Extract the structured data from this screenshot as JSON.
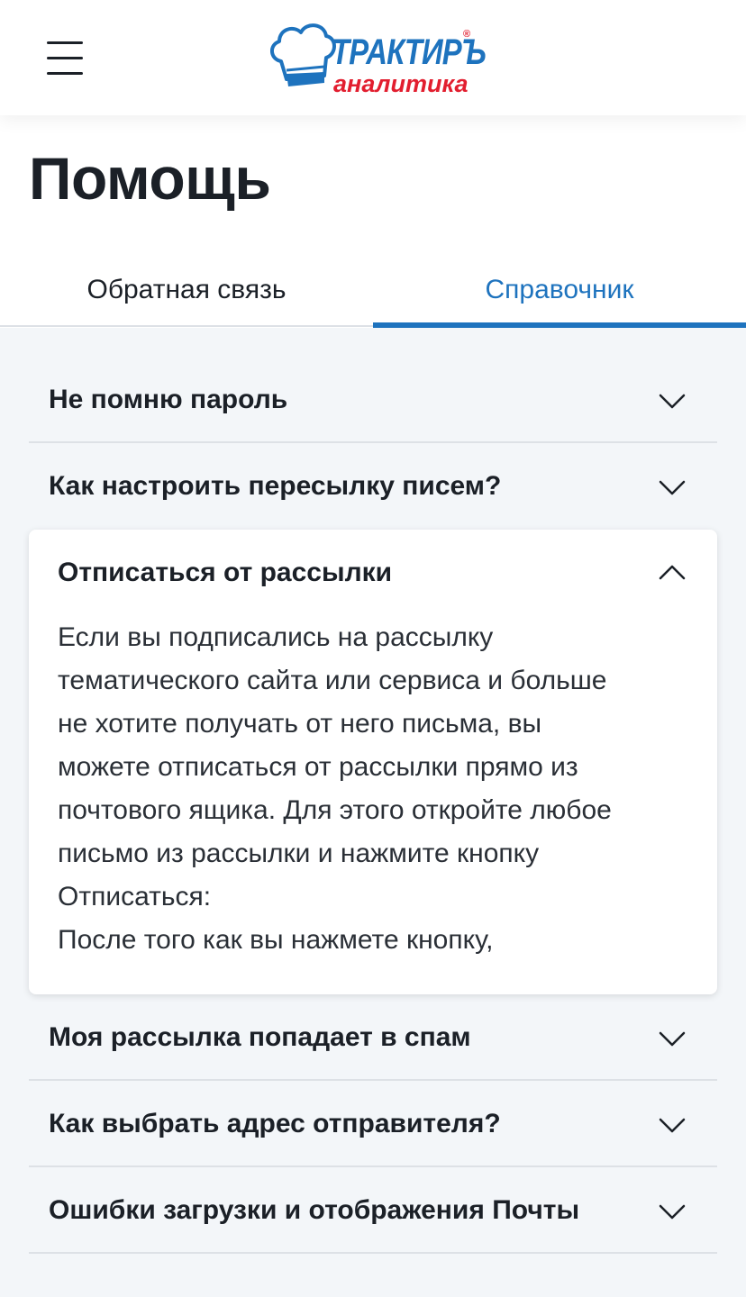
{
  "header": {
    "logo_main": "ТРАКТИРЪ",
    "logo_reg": "®",
    "logo_sub": "аналитика",
    "menu_icon": "hamburger-menu-icon"
  },
  "page": {
    "title": "Помощь"
  },
  "tabs": [
    {
      "label": "Обратная связь",
      "active": false
    },
    {
      "label": "Справочник",
      "active": true
    }
  ],
  "faq": {
    "items": [
      {
        "question": "Не помню пароль",
        "expanded": false
      },
      {
        "question": "Как настроить пересылку писем?",
        "expanded": false
      },
      {
        "question": "Отписаться от рассылки",
        "expanded": true
      },
      {
        "question": "Моя рассылка попадает в спам",
        "expanded": false
      },
      {
        "question": "Как выбрать адрес отправителя?",
        "expanded": false
      },
      {
        "question": "Ошибки загрузки и отображения Почты",
        "expanded": false
      }
    ],
    "open_answer_lines": [
      "Если вы подписались на рассылку",
      "тематического сайта или сервиса и больше",
      "не хотите получать от него письма, вы",
      "можете отписаться от рассылки прямо из",
      "почтового ящика. Для этого откройте любое",
      "письмо из рассылки и нажмите кнопку",
      "Отписаться:",
      "После того как вы нажмете кнопку,"
    ]
  },
  "colors": {
    "accent": "#1e73be",
    "brand_red": "#e21e2f",
    "text": "#1b2027",
    "background": "#f3f6f9"
  }
}
